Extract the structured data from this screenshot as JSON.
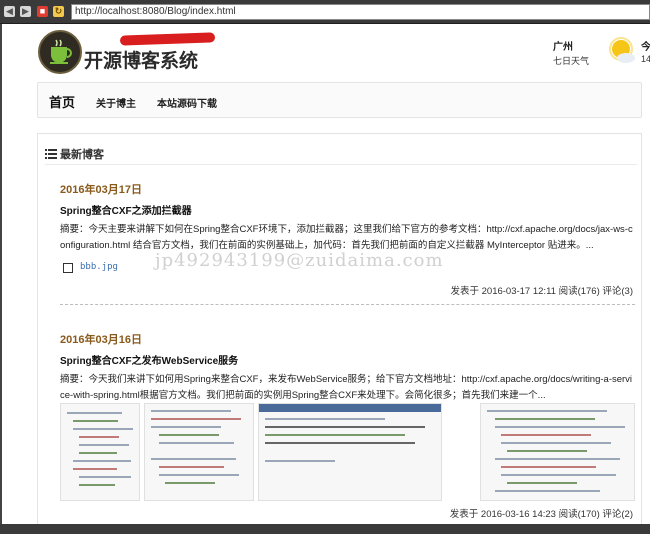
{
  "browser": {
    "address": "http://localhost:8080/Blog/index.html",
    "icons": [
      "back-icon",
      "forward-icon",
      "stop-icon",
      "reload-icon"
    ]
  },
  "header": {
    "logo_text": "开源博客系统",
    "city": "广州",
    "week_weather": "七日天气",
    "today": "今",
    "temp": "14",
    "weather_icon": "sun-cloud-icon"
  },
  "nav": {
    "home": "首页",
    "about": "关于博主",
    "source": "本站源码下载"
  },
  "section": {
    "title": "最新博客",
    "icon": "list-icon"
  },
  "posts": [
    {
      "date": "2016年03月17日",
      "title": "Spring整合CXF之添加拦截器",
      "summary": "摘要：今天主要来讲解下如何在Spring整合CXF环境下，添加拦截器；这里我们给下官方的参考文档：http://cxf.apache.org/docs/jax-ws-configuration.html 结合官方文档，我们在前面的实例基础上，加代码：首先我们把前面的自定义拦截器 MyInterceptor 贴进来。...",
      "attachment": "bbb.jpg",
      "info": "发表于  2016-03-17 12:11 阅读(176) 评论(3)"
    },
    {
      "date": "2016年03月16日",
      "title": "Spring整合CXF之发布WebService服务",
      "summary": "摘要：今天我们来讲下如何用Spring来整合CXF，来发布WebService服务；给下官方文档地址：http://cxf.apache.org/docs/writing-a-service-with-spring.html根据官方文档。我们把前面的实例用Spring整合CXF来处理下。会简化很多；首先我们来建一个...",
      "info": "发表于  2016-03-16 14:23 阅读(170) 评论(2)"
    }
  ],
  "watermark": "jp492943199@zuidaima.com",
  "colors": {
    "date": "#8a5a1c",
    "link": "#3a6fb0",
    "chrome": "#3a3a3a"
  }
}
